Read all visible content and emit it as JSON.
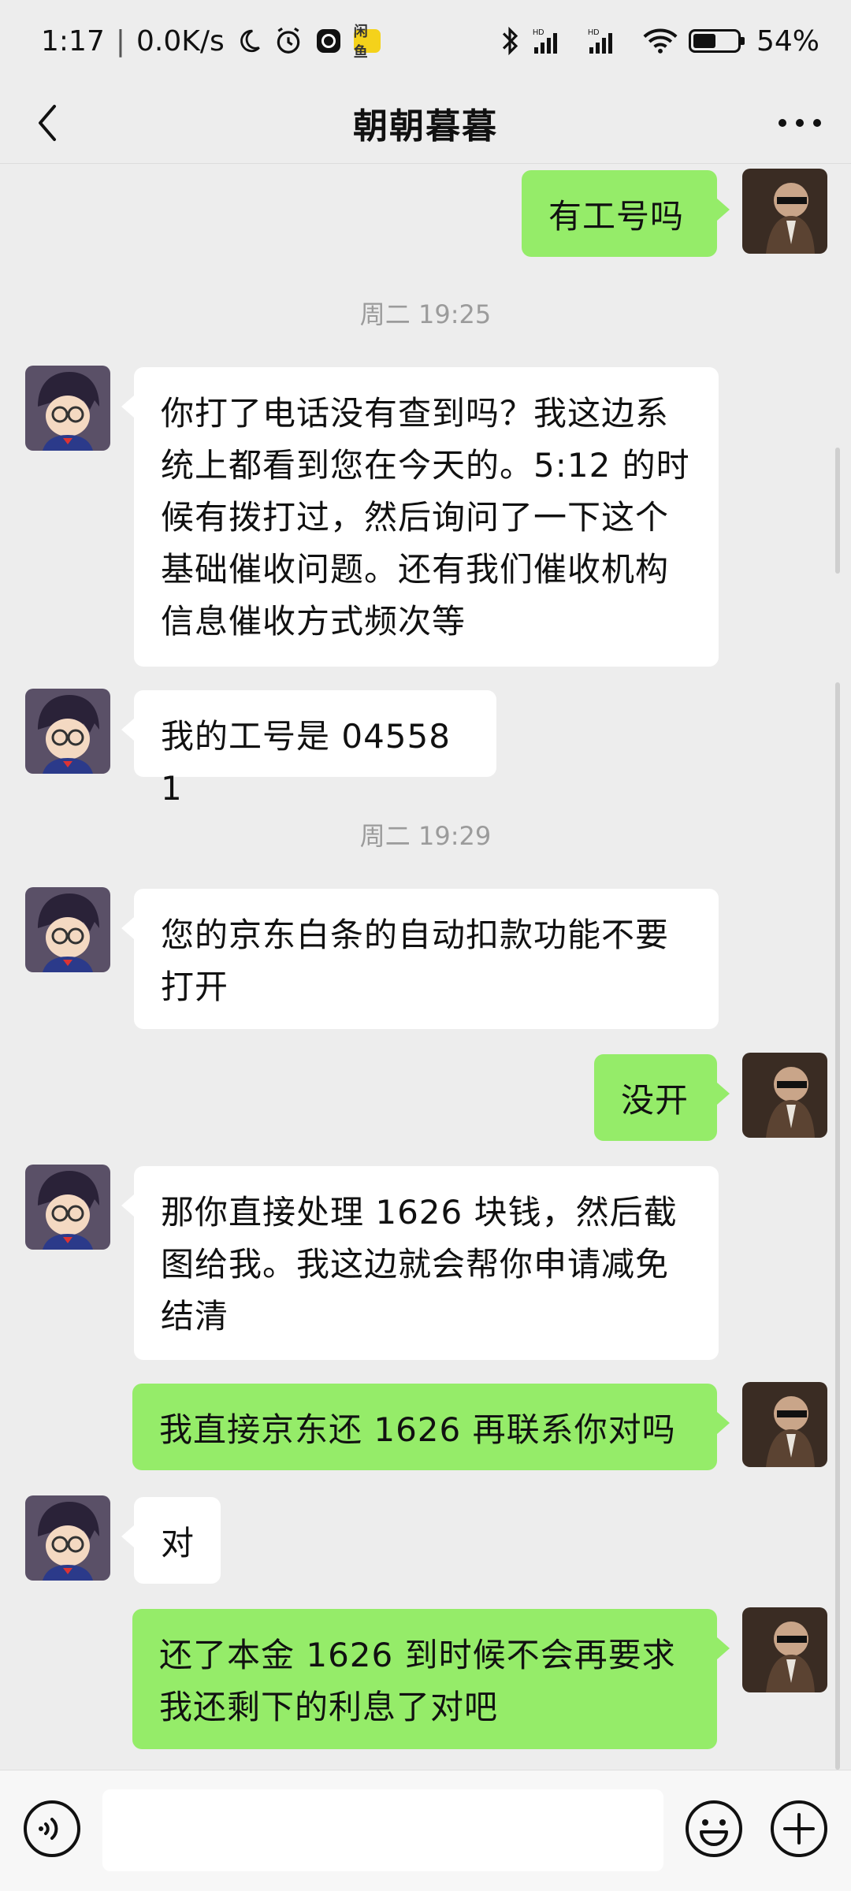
{
  "status_bar": {
    "time": "1:17",
    "net_speed": "0.0K/s",
    "app_badge": "闲鱼",
    "battery_percent": "54%",
    "battery_level": 0.54,
    "icons": [
      "moon-icon",
      "alarm-icon",
      "app-icon",
      "bluetooth-icon",
      "signal-icon",
      "wifi-icon",
      "battery-icon"
    ]
  },
  "header": {
    "title": "朝朝暮暮"
  },
  "messages": [
    {
      "side": "out",
      "text": "有工号吗"
    },
    {
      "type": "time",
      "text": "周二 19:25"
    },
    {
      "side": "in",
      "text": "你打了电话没有查到吗？我这边系统上都看到您在今天的。5:12 的时候有拨打过，然后询问了一下这个基础催收问题。还有我们催收机构信息催收方式频次等"
    },
    {
      "side": "in",
      "text": "我的工号是 045581"
    },
    {
      "type": "time",
      "text": "周二 19:29"
    },
    {
      "side": "in",
      "text": "您的京东白条的自动扣款功能不要打开"
    },
    {
      "side": "out",
      "text": "没开"
    },
    {
      "side": "in",
      "text": "那你直接处理 1626 块钱，然后截图给我。我这边就会帮你申请减免结清"
    },
    {
      "side": "out",
      "text": "我直接京东还 1626 再联系你对吗"
    },
    {
      "side": "in",
      "text": "对"
    },
    {
      "side": "out",
      "text": "还了本金 1626 到时候不会再要求我还剩下的利息了对吧"
    }
  ],
  "input_bar": {
    "value": "",
    "icons": [
      "voice-icon",
      "emoji-icon",
      "plus-icon"
    ]
  },
  "colors": {
    "background": "#ededed",
    "outgoing_bubble": "#95ec69",
    "incoming_bubble": "#ffffff"
  }
}
